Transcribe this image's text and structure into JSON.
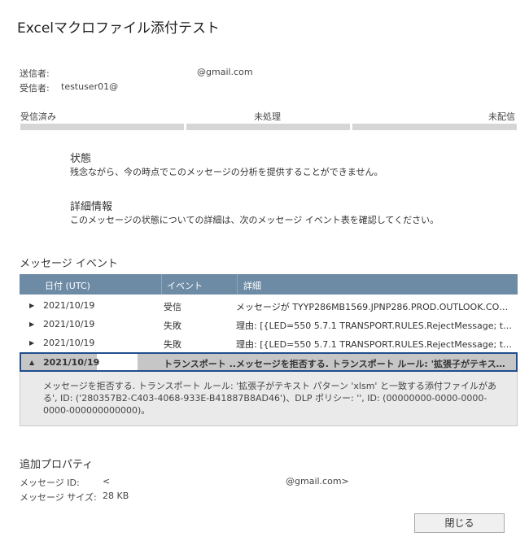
{
  "title": "Excelマクロファイル添付テスト",
  "sender": {
    "label": "送信者:",
    "value": "@gmail.com"
  },
  "recipient": {
    "label": "受信者:",
    "value": "testuser01@"
  },
  "progress": {
    "received": "受信済み",
    "pending": "未処理",
    "undelivered": "未配信"
  },
  "status": {
    "heading": "状態",
    "text": "残念ながら、今の時点でこのメッセージの分析を提供することができません。"
  },
  "details": {
    "heading": "詳細情報",
    "text": "このメッセージの状態についての詳細は、次のメッセージ イベント表を確認してください。"
  },
  "events": {
    "heading": "メッセージ イベント",
    "columns": {
      "date": "日付 (UTC)",
      "event": "イベント",
      "detail": "詳細"
    },
    "rows": [
      {
        "date": "2021/10/19",
        "event": "受信",
        "detail": "メッセージが TYYP286MB1569.JPNP286.PROD.OUTLOOK.COM ..."
      },
      {
        "date": "2021/10/19",
        "event": "失敗",
        "detail": "理由: [{LED=550 5.7.1 TRANSPORT.RULES.RejectMessage; the m..."
      },
      {
        "date": "2021/10/19",
        "event": "失敗",
        "detail": "理由: [{LED=550 5.7.1 TRANSPORT.RULES.RejectMessage; the m..."
      },
      {
        "date": "2021/10/19",
        "event": "トランスポート ...",
        "detail": "メッセージを拒否する. トランスポート ルール: '拡張子がテキスト パ..."
      }
    ],
    "expanded_text": "メッセージを拒否する. トランスポート ルール: '拡張子がテキスト パターン 'xlsm' と一致する添付ファイルがある', ID: ('280357B2-C403-4068-933E-B41887B8AD46')、DLP ポリシー: '', ID: (00000000-0000-0000-0000-000000000000)。"
  },
  "props": {
    "heading": "追加プロパティ",
    "message_id_label": "メッセージ ID:",
    "message_id_prefix": "<",
    "message_id_suffix": "@gmail.com>",
    "size_label": "メッセージ サイズ:",
    "size_value": "28 KB"
  },
  "close_button": "閉じる",
  "colors": {
    "header": "#6e8ba5",
    "selection_border": "#1f4e8c",
    "progress": "#d6d6d6"
  }
}
